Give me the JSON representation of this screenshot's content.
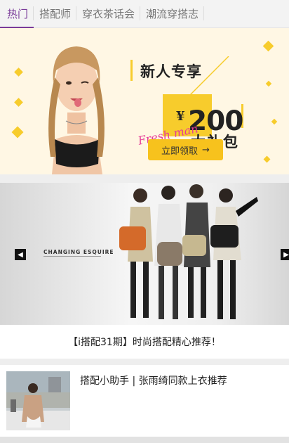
{
  "tabs": [
    {
      "label": "热门",
      "active": true
    },
    {
      "label": "搭配师",
      "active": false
    },
    {
      "label": "穿衣茶话会",
      "active": false
    },
    {
      "label": "潮流穿搭志",
      "active": false
    }
  ],
  "banner_promo": {
    "title": "新人专享",
    "currency": "¥",
    "amount": "200",
    "gift": "大礼包",
    "tagline": "Fresh man",
    "button_label": "立即领取",
    "button_icon": "arrow-right-icon",
    "accent_color": "#f7cc2c",
    "carousel_pages": 2,
    "carousel_active": 1
  },
  "banner_feature": {
    "brand": "CHANGING ESQUIRE",
    "prev_icon": "chevron-left-icon",
    "next_icon": "chevron-right-icon"
  },
  "feature_caption": "【i搭配31期】时尚搭配精心推荐！",
  "article": {
    "title": "搭配小助手 | 张雨绮同款上衣推荐"
  },
  "colors": {
    "active_tab": "#7a3b99",
    "carousel_dot_active": "#a064b8"
  }
}
